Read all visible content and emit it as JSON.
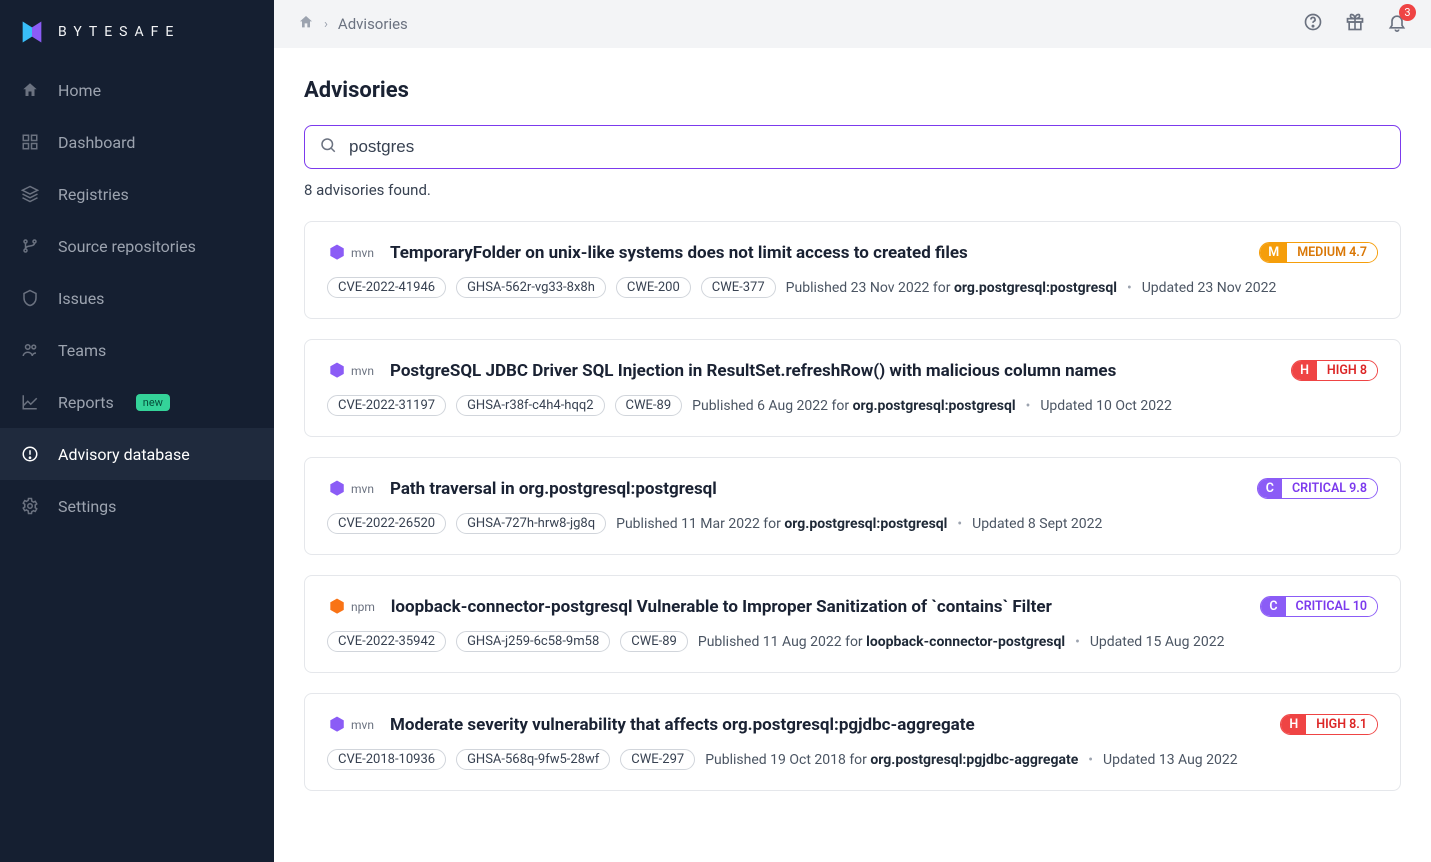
{
  "brand": {
    "name": "BYTESAFE"
  },
  "sidebar": {
    "items": [
      {
        "label": "Home"
      },
      {
        "label": "Dashboard"
      },
      {
        "label": "Registries"
      },
      {
        "label": "Source repositories"
      },
      {
        "label": "Issues"
      },
      {
        "label": "Teams"
      },
      {
        "label": "Reports",
        "badge": "new"
      },
      {
        "label": "Advisory database"
      },
      {
        "label": "Settings"
      }
    ]
  },
  "topbar": {
    "breadcrumb": "Advisories",
    "notification_count": "3"
  },
  "page": {
    "title": "Advisories",
    "search_value": "postgres",
    "result_count": "8 advisories found."
  },
  "advisories": [
    {
      "ecosystem": "mvn",
      "eco_color": "#8b5cf6",
      "title": "TemporaryFolder on unix-like systems does not limit access to created files",
      "severity_class": "medium",
      "severity_letter": "M",
      "severity_label": "MEDIUM 4.7",
      "tags": [
        "CVE-2022-41946",
        "GHSA-562r-vg33-8x8h",
        "CWE-200",
        "CWE-377"
      ],
      "published_prefix": "Published 23 Nov 2022 for ",
      "package": "org.postgresql:postgresql",
      "updated": "Updated 23 Nov 2022"
    },
    {
      "ecosystem": "mvn",
      "eco_color": "#8b5cf6",
      "title": "PostgreSQL JDBC Driver SQL Injection in ResultSet.refreshRow() with malicious column names",
      "severity_class": "high",
      "severity_letter": "H",
      "severity_label": "HIGH 8",
      "tags": [
        "CVE-2022-31197",
        "GHSA-r38f-c4h4-hqq2",
        "CWE-89"
      ],
      "published_prefix": "Published 6 Aug 2022 for ",
      "package": "org.postgresql:postgresql",
      "updated": "Updated 10 Oct 2022"
    },
    {
      "ecosystem": "mvn",
      "eco_color": "#8b5cf6",
      "title": "Path traversal in org.postgresql:postgresql",
      "severity_class": "critical",
      "severity_letter": "C",
      "severity_label": "CRITICAL 9.8",
      "tags": [
        "CVE-2022-26520",
        "GHSA-727h-hrw8-jg8q"
      ],
      "published_prefix": "Published 11 Mar 2022 for ",
      "package": "org.postgresql:postgresql",
      "updated": "Updated 8 Sept 2022"
    },
    {
      "ecosystem": "npm",
      "eco_color": "#f97316",
      "title": "loopback-connector-postgresql Vulnerable to Improper Sanitization of `contains` Filter",
      "severity_class": "critical",
      "severity_letter": "C",
      "severity_label": "CRITICAL 10",
      "tags": [
        "CVE-2022-35942",
        "GHSA-j259-6c58-9m58",
        "CWE-89"
      ],
      "published_prefix": "Published 11 Aug 2022 for ",
      "package": "loopback-connector-postgresql",
      "updated": "Updated 15 Aug 2022"
    },
    {
      "ecosystem": "mvn",
      "eco_color": "#8b5cf6",
      "title": "Moderate severity vulnerability that affects org.postgresql:pgjdbc-aggregate",
      "severity_class": "high",
      "severity_letter": "H",
      "severity_label": "HIGH 8.1",
      "tags": [
        "CVE-2018-10936",
        "GHSA-568q-9fw5-28wf",
        "CWE-297"
      ],
      "published_prefix": "Published 19 Oct 2018 for ",
      "package": "org.postgresql:pgjdbc-aggregate",
      "updated": "Updated 13 Aug 2022"
    }
  ]
}
